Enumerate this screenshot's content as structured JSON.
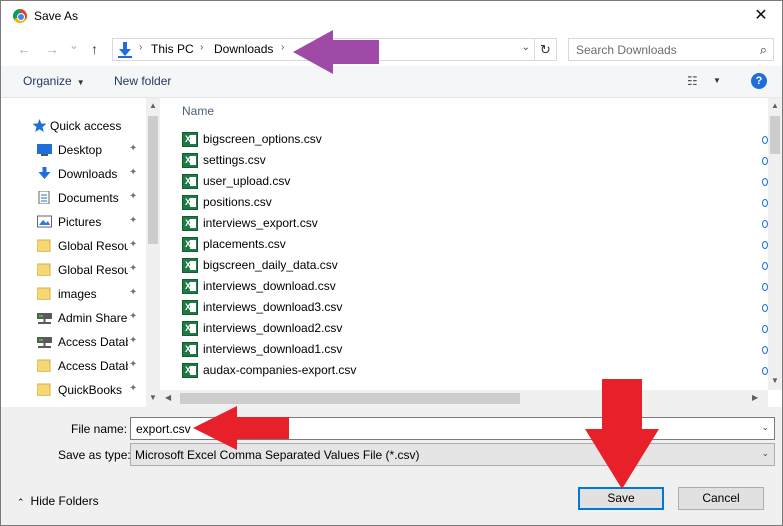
{
  "window": {
    "title": "Save As",
    "close_glyph": "✕"
  },
  "nav_buttons": {
    "back": "←",
    "forward": "→",
    "recent": "⌄",
    "up": "↑"
  },
  "address": {
    "crumbs": [
      "This PC",
      "Downloads"
    ],
    "separator": "›",
    "dropdown_glyph": "⌄",
    "refresh_glyph": "↻"
  },
  "search": {
    "placeholder": "Search Downloads",
    "icon_glyph": "⌕"
  },
  "toolbar": {
    "organize_label": "Organize",
    "new_folder_label": "New folder",
    "caret": "▼",
    "view_glyph": "☷",
    "help_glyph": "?"
  },
  "nav_pane": {
    "items": [
      {
        "label": "Quick access",
        "icon": "star-icon",
        "pinned": false
      },
      {
        "label": "Desktop",
        "icon": "desktop-icon",
        "pinned": true
      },
      {
        "label": "Downloads",
        "icon": "download-icon",
        "pinned": true
      },
      {
        "label": "Documents",
        "icon": "document-icon",
        "pinned": true
      },
      {
        "label": "Pictures",
        "icon": "pictures-icon",
        "pinned": true
      },
      {
        "label": "Global Resou",
        "icon": "folder-icon",
        "pinned": true
      },
      {
        "label": "Global Resou",
        "icon": "folder-icon",
        "pinned": true
      },
      {
        "label": "images",
        "icon": "folder-icon",
        "pinned": true
      },
      {
        "label": "Admin Share",
        "icon": "network-drive-icon",
        "pinned": true
      },
      {
        "label": "Access Datab",
        "icon": "network-drive-icon",
        "pinned": true
      },
      {
        "label": "Access Datab",
        "icon": "folder-icon",
        "pinned": true
      },
      {
        "label": "QuickBooks",
        "icon": "folder-icon",
        "pinned": true
      }
    ],
    "pin_glyph": "📌"
  },
  "file_list": {
    "column_name": "Name",
    "files": [
      "bigscreen_options.csv",
      "settings.csv",
      "user_upload.csv",
      "positions.csv",
      "interviews_export.csv",
      "placements.csv",
      "bigscreen_daily_data.csv",
      "interviews_download.csv",
      "interviews_download3.csv",
      "interviews_download2.csv",
      "interviews_download1.csv",
      "audax-companies-export.csv"
    ],
    "file_icon_letter": "X"
  },
  "form": {
    "file_name_label": "File name:",
    "file_name_value": "export.csv",
    "save_as_type_label": "Save as type:",
    "save_as_type_value": "Microsoft Excel Comma Separated Values File (*.csv)",
    "dropdown_glyph": "⌄"
  },
  "footer": {
    "hide_folders_label": "Hide Folders",
    "hide_folders_glyph": "⌃",
    "save_label": "Save",
    "cancel_label": "Cancel"
  },
  "colors": {
    "annotation_purple": "#a04aa8",
    "annotation_red": "#e8202a",
    "excel_green": "#1d7a43",
    "accent_blue": "#0078d7"
  }
}
